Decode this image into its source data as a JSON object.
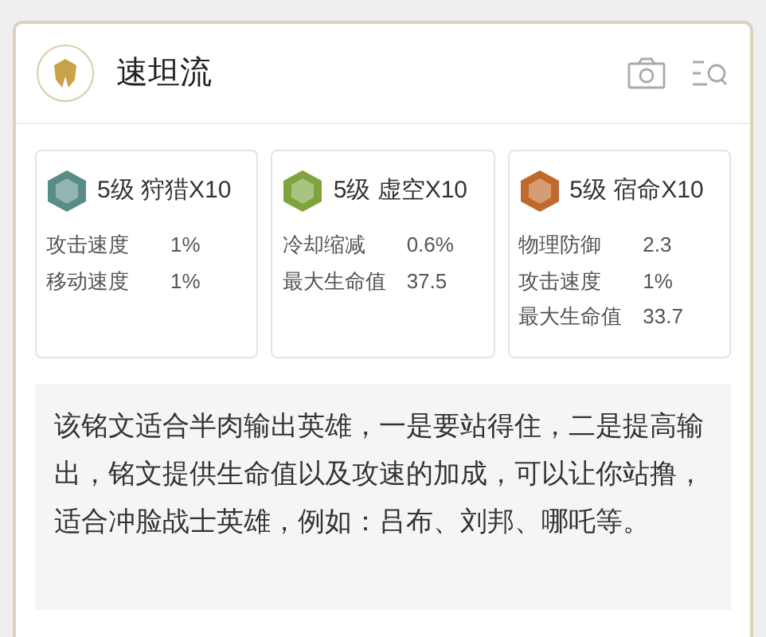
{
  "header": {
    "title": "速坦流"
  },
  "runes": [
    {
      "title": "5级 狩猎X10",
      "color": "#5a8c86",
      "stats": [
        {
          "name": "攻击速度",
          "value": "1%"
        },
        {
          "name": "移动速度",
          "value": "1%"
        }
      ]
    },
    {
      "title": "5级 虚空X10",
      "color": "#7fa43c",
      "stats": [
        {
          "name": "冷却缩减",
          "value": "0.6%"
        },
        {
          "name": "最大生命值",
          "value": "37.5"
        }
      ]
    },
    {
      "title": "5级 宿命X10",
      "color": "#c0692c",
      "stats": [
        {
          "name": "物理防御",
          "value": "2.3"
        },
        {
          "name": "攻击速度",
          "value": "1%"
        },
        {
          "name": "最大生命值",
          "value": "33.7"
        }
      ]
    }
  ],
  "description": "该铭文适合半肉输出英雄，一是要站得住，二是提高输出，铭文提供生命值以及攻速的加成，可以让你站撸，适合冲脸战士英雄，例如：吕布、刘邦、哪吒等。"
}
